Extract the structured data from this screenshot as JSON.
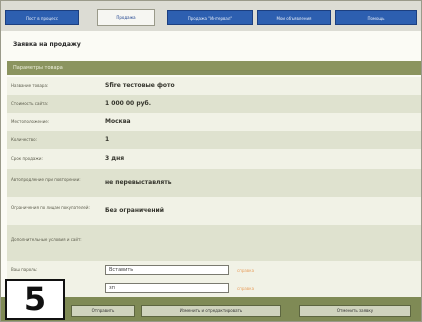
{
  "tabs": [
    {
      "label": "Пост в процесс"
    },
    {
      "label": "Продажа"
    },
    {
      "label": "Продажа \"Интервал\""
    },
    {
      "label": "Мои объявления"
    },
    {
      "label": "Помощь"
    }
  ],
  "page_title": "Заявка на продажу",
  "section_title": "Параметры товара",
  "fields": [
    {
      "label": "Название товара:",
      "value": "Sfire тестовые фото"
    },
    {
      "label": "Стоимость сайта:",
      "value": "1 000 00 руб."
    },
    {
      "label": "Местоположение:",
      "value": "Москва"
    },
    {
      "label": "Количество:",
      "value": "1"
    },
    {
      "label": "Срок продажи:",
      "value": "3 дня"
    },
    {
      "label": "Автопродление при повторении:",
      "value": "не перевыставлять"
    },
    {
      "label": "Ограничения по лицам покупателей:",
      "value": "Без ограничений"
    },
    {
      "label": "Дополнительные условия и сайт:",
      "value": ""
    }
  ],
  "inputs": [
    {
      "label": "Ваш пароль:",
      "value": "Вставить",
      "hint": "справка"
    },
    {
      "label": "",
      "value": "зп",
      "hint": "справка"
    }
  ],
  "buttons": [
    {
      "label": "Отправить"
    },
    {
      "label": "Изменить и отредактировать"
    },
    {
      "label": "Отменить заявку"
    }
  ],
  "badge": "5"
}
